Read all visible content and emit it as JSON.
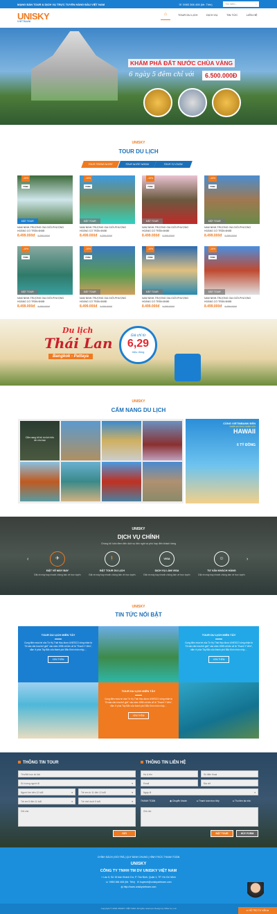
{
  "topbar": {
    "tagline": "MẠNG BÁN TOUR & DỊCH VỤ TRỰC TUYẾN HÀNG ĐẦU VIỆT NAM",
    "phone": "0983 366 408 (Mr. Tiến)",
    "search_placeholder": "Tìm kiếm..."
  },
  "header": {
    "logo": "UNISKY",
    "logo_sub": "VIETNAM",
    "nav": [
      "TOUR DU LỊCH",
      "DỊCH VỤ",
      "TIN TỨC",
      "LIÊN HỆ"
    ]
  },
  "hero": {
    "title": "KHÁM PHÁ ĐẤT NƯỚC CHÙA VÀNG",
    "subtitle": "6 ngày 5 đêm chỉ với",
    "price": "6.500.000Đ"
  },
  "tours": {
    "logo": "UNISKY",
    "title": "TOUR DU LỊCH",
    "tabs": [
      "TOUR TRONG NƯỚC",
      "TOUR NƯỚC NGOÀI",
      "TOUR TỰ CHỌN"
    ],
    "active_tab": 0,
    "items": [
      {
        "discount": "-10%",
        "days": "7N6Đ",
        "book": "ĐẶT TOUR",
        "name": "NAM NINH-TRƯƠNG GIA GIỚI-PHƯỢNG HOÀNG CỔ TRẤN 6N5Đ",
        "price": "8.499.000đ",
        "old": "9.299.000đ"
      },
      {
        "discount": "-10%",
        "days": "7N6Đ",
        "book": "ĐẶT TOUR",
        "name": "NAM NINH-TRƯƠNG GIA GIỚI-PHƯỢNG HOÀNG CỔ TRẤN 6N5Đ",
        "price": "8.499.000đ",
        "old": "9.299.000đ"
      },
      {
        "discount": "-10%",
        "days": "7N6Đ",
        "book": "ĐẶT TOUR",
        "name": "NAM NINH-TRƯƠNG GIA GIỚI-PHƯỢNG HOÀNG CỔ TRẤN 6N5Đ",
        "price": "8.499.000đ",
        "old": "9.299.000đ"
      },
      {
        "discount": "-10%",
        "days": "7N6Đ",
        "book": "ĐẶT TOUR",
        "name": "NAM NINH-TRƯƠNG GIA GIỚI-PHƯỢNG HOÀNG CỔ TRẤN 6N5Đ",
        "price": "8.499.000đ",
        "old": "9.299.000đ"
      },
      {
        "discount": "-10%",
        "days": "7N6Đ",
        "book": "ĐẶT TOUR",
        "name": "NAM NINH-TRƯƠNG GIA GIỚI-PHƯỢNG HOÀNG CỔ TRẤN 6N5Đ",
        "price": "8.499.000đ",
        "old": "9.299.000đ"
      },
      {
        "discount": "-10%",
        "days": "7N6Đ",
        "book": "ĐẶT TOUR",
        "name": "NAM NINH-TRƯƠNG GIA GIỚI-PHƯỢNG HOÀNG CỔ TRẤN 6N5Đ",
        "price": "8.499.000đ",
        "old": "9.299.000đ"
      },
      {
        "discount": "-10%",
        "days": "7N6Đ",
        "book": "ĐẶT TOUR",
        "name": "NAM NINH-TRƯƠNG GIA GIỚI-PHƯỢNG HOÀNG CỔ TRẤN 6N5Đ",
        "price": "8.499.000đ",
        "old": "9.299.000đ"
      },
      {
        "discount": "-10%",
        "days": "7N6Đ",
        "book": "ĐẶT TOUR",
        "name": "NAM NINH-TRƯƠNG GIA GIỚI-PHƯỢNG HOÀNG CỔ TRẤN 6N5Đ",
        "price": "8.499.000đ",
        "old": "9.299.000đ"
      }
    ]
  },
  "thai_banner": {
    "line1": "Du lịch",
    "line2": "Thái Lan",
    "places": "Bangkok - Pattaya",
    "from": "Giá chỉ từ",
    "price": "6,29",
    "unit": "triệu đồng"
  },
  "guide": {
    "logo": "UNISKY",
    "title": "CẨM NANG DU LỊCH",
    "overlay": "Cẩm nang bỏ túi du lịch hữu ích cho bạn",
    "ad_title": "CÙNG VIETINBANK ĐẾN",
    "ad_sub": "THIÊN ĐƯỜNG NHIỆT ĐỚI",
    "ad_big": "HAWAII",
    "ad_prize": "6 TỶ ĐỒNG"
  },
  "services": {
    "logo": "UNISKY",
    "title": "DỊCH VỤ CHÍNH",
    "subtitle": "Chúng tôi luôn đem đến dịch vụ tiện nghi và phù hợp đến khách hàng",
    "items": [
      {
        "icon": "✈",
        "title": "ĐẶT VÉ MÁY BAY",
        "desc": "Đặt vé máy bay nhanh chóng bán vé trực tuyến"
      },
      {
        "icon": "🚶",
        "title": "ĐẶT TOUR DU LỊCH",
        "desc": "Đặt vé máy bay nhanh chóng bán vé trực tuyến"
      },
      {
        "icon": "VISA",
        "title": "DỊCH VỤ LÀM VISA",
        "desc": "Đặt vé máy bay nhanh chóng bán vé trực tuyến"
      },
      {
        "icon": "☺",
        "title": "TƯ VẤN KHÁCH HÀNG",
        "desc": "Đặt vé máy bay nhanh chóng bán vé trực tuyến"
      }
    ]
  },
  "news": {
    "logo": "UNISKY",
    "title": "TIN TỨC NỔI BẬT",
    "items": [
      {
        "title": "TOUR DU LỊCH MIỀN TÂY",
        "desc": "Cung điện mùa hè của Từ Hy Thái Hậu được UNESCO công nhận là \"Di sản văn hóa thế giới\" vào năm 1998 với tên cổ là \"Thanh Y Viên\", nằm ở phía Tây Bắc của thành phố Bắc Kinh nhộn nhịp....",
        "button": "XEM THÊM"
      },
      {
        "title": "TOUR DU LỊCH MIỀN TÂY",
        "desc": "Cung điện mùa hè của Từ Hy Thái Hậu được UNESCO công nhận là \"Di sản văn hóa thế giới\" vào năm 1998 với tên cổ là \"Thanh Y Viên\", nằm ở phía Tây Bắc của thành phố Bắc Kinh nhộn nhịp....",
        "button": "XEM THÊM"
      },
      {
        "title": "TOUR DU LỊCH MIỀN TÂY",
        "desc": "Cung điện mùa hè của Từ Hy Thái Hậu được UNESCO công nhận là \"Di sản văn hóa thế giới\" vào năm 1998 với tên cổ là \"Thanh Y Viên\", nằm ở phía Tây Bắc của thành phố Bắc Kinh nhộn nhịp....",
        "button": "XEM THÊM"
      }
    ]
  },
  "tour_form": {
    "title": "THÔNG TIN TOUR",
    "tour_name": "Tên/Mã tour du lịch",
    "count": "Số lượng người đi",
    "adult": "Người lớn trên 12 tuổi",
    "child1": "Trẻ em từ 11 đến 12 tuổi",
    "child2": "Trẻ em 5 đến 11 tuổi",
    "child3": "Trẻ nhỏ dưới 5 tuổi",
    "note": "Ghi chú",
    "submit": "GỬI"
  },
  "contact_form": {
    "title": "THÔNG TIN LIÊN HỆ",
    "name": "Họ & tên",
    "phone": "Số điện thoại",
    "email": "Email",
    "address": "Địa chỉ",
    "date": "Ngày đi",
    "payment_label": "THANH TOÁN",
    "payments": [
      "Chuyển khoản",
      "Thanh toán trực tiếp",
      "Thu tiền tại nhà"
    ],
    "selected_payment": 0,
    "note": "Ghi chú",
    "book": "ĐẶT TOUR",
    "cancel": "HỦY FORM"
  },
  "footer": {
    "links": [
      "CHÍNH SÁCH",
      "ĐỔI TRẢ",
      "QUY ĐỊNH CHUNG",
      "HÌNH THỨC THANH TOÁN"
    ],
    "logo": "UNISKY",
    "company": "CÔNG TY TNHH TM DV UNISKY VIỆT NAM",
    "address": "Lầu 5, Số 15 trần Khánh Dư, P. Tân Định, Quận 1, TP. Hồ Chí Minh",
    "phone": "0983 366 408 (Mr. Tiến)",
    "email": "huyennt@uniskyvietnam.com",
    "web": "http://www.uniskyvietnam.com",
    "copyright": "Copyright © 2018 UNISKY VIỆT NAM. All rights reserved. Design by NiNa Co.,Ltd",
    "support": "HỖ TRỢ TƯ VẤN"
  },
  "colors": {
    "blue": "#1b7fd1",
    "orange": "#ef7a20"
  }
}
